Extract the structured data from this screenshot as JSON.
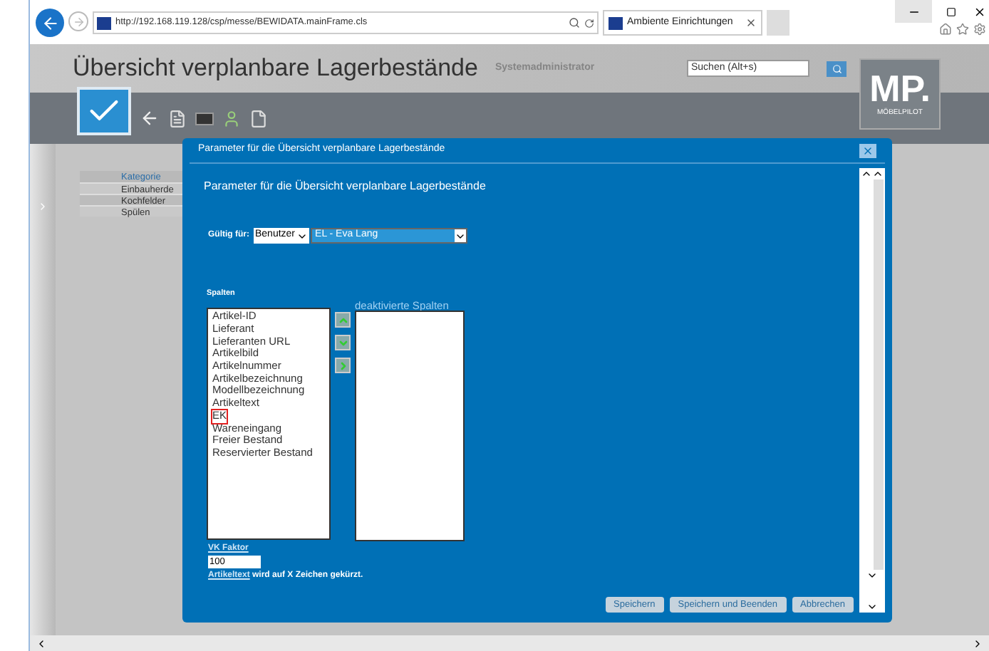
{
  "browser": {
    "address": "http://192.168.119.128/csp/messe/BEWIDATA.mainFrame.cls",
    "tab_title": "Ambiente Einrichtungen"
  },
  "app": {
    "title": "Übersicht verplanbare Lagerbestände",
    "user": "Systemadministrator",
    "search_placeholder": "Suchen (Alt+s)",
    "logo": "MP.",
    "logo_caption": "MÖBELPILOT"
  },
  "nav": {
    "header": "Kategorie",
    "items": [
      {
        "label": "Einbauherde",
        "selected": false
      },
      {
        "label": "Kochfelder",
        "selected": false
      },
      {
        "label": "Spülen",
        "selected": false
      }
    ]
  },
  "dialog": {
    "title": "Parameter für die Übersicht verplanbare Lagerbestände",
    "heading": "Parameter für die Übersicht verplanbare Lagerbestände",
    "valid_for_label": "Gültig für:",
    "valid_for_type": "Benutzer",
    "valid_for_user": "EL - Eva Lang",
    "columns_label": "Spalten",
    "deactivated_label": "deaktivierte Spalten",
    "columns": [
      {
        "label": "Artikel-ID",
        "marked": false
      },
      {
        "label": "Lieferant",
        "marked": false
      },
      {
        "label": "Lieferanten URL",
        "marked": false
      },
      {
        "label": "Artikelbild",
        "marked": false
      },
      {
        "label": "Artikelnummer",
        "marked": false
      },
      {
        "label": "Artikelbezeichnung",
        "marked": false
      },
      {
        "label": "Modellbezeichnung",
        "marked": false
      },
      {
        "label": "Artikeltext",
        "marked": false
      },
      {
        "label": "EK",
        "marked": true
      },
      {
        "label": "Wareneingang",
        "marked": false
      },
      {
        "label": "Freier Bestand",
        "marked": false
      },
      {
        "label": "Reservierter Bestand",
        "marked": false
      }
    ],
    "vk_label": "VK Faktor",
    "vk_value": "100",
    "trim_link": "Artikeltext",
    "trim_text": "wird auf X Zeichen gekürzt.",
    "buttons": [
      "Speichern",
      "Speichern und Beenden",
      "Abbrechen"
    ]
  }
}
